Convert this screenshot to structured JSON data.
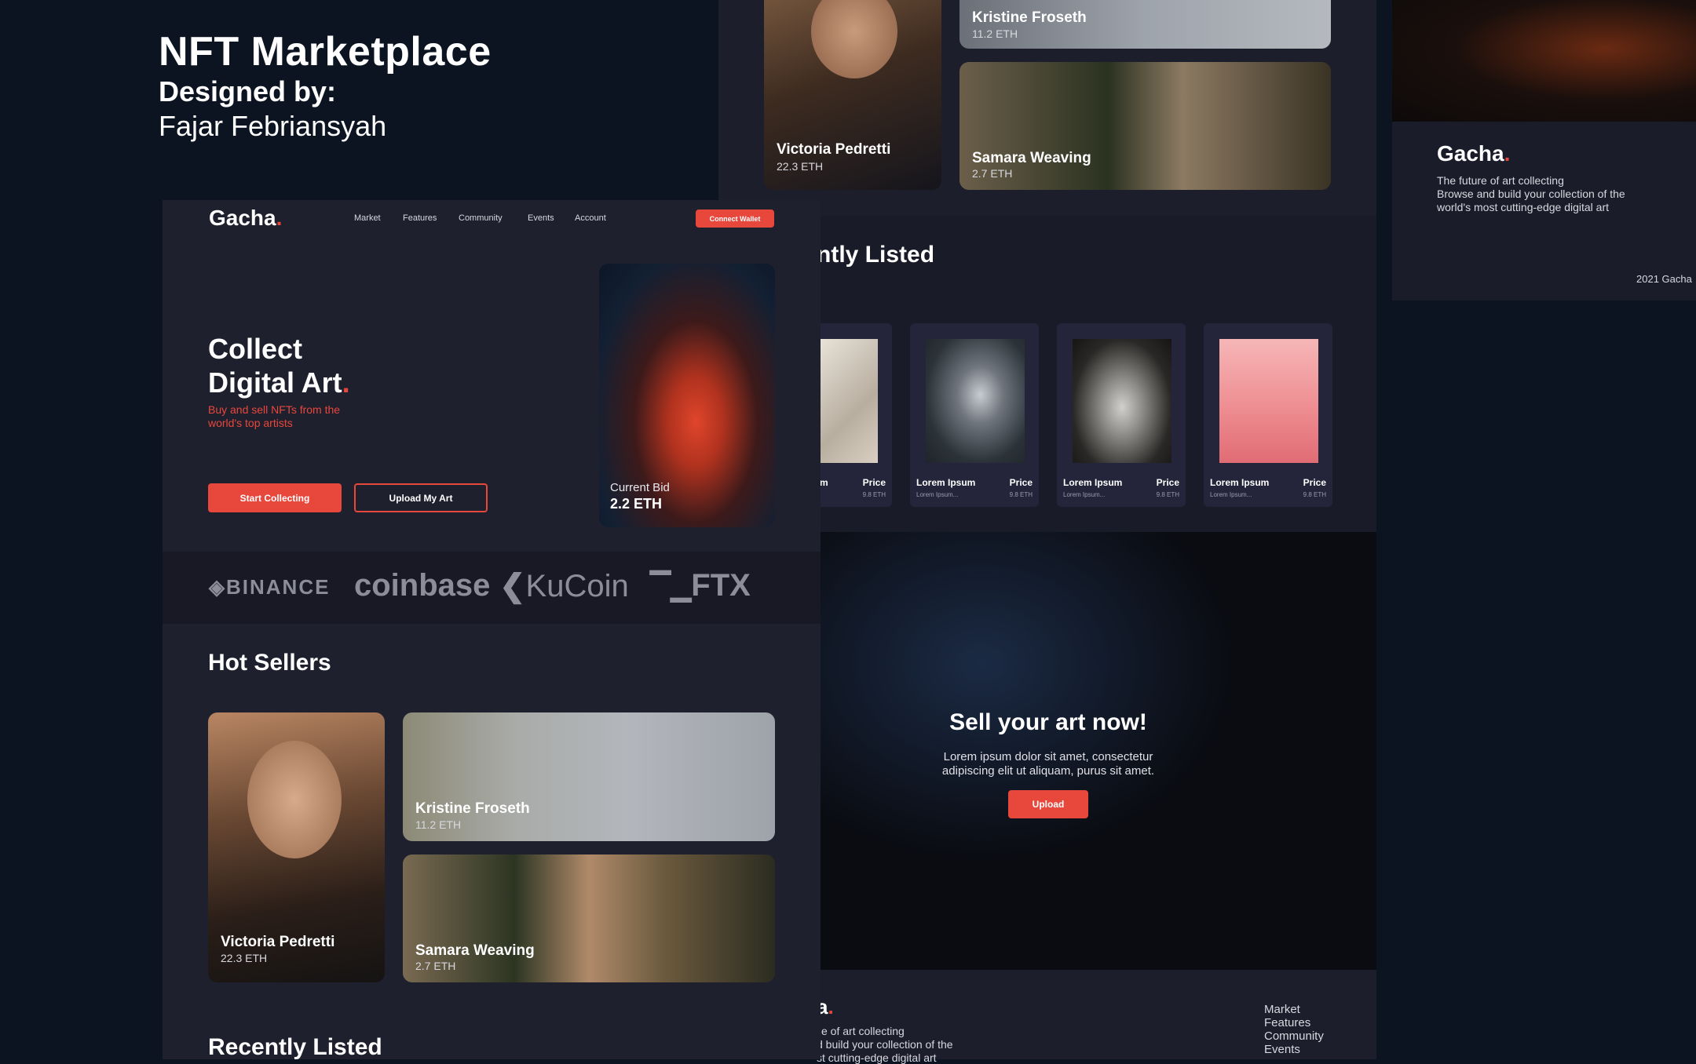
{
  "header": {
    "title": "NFT Marketplace",
    "designed_by": "Designed by:",
    "author": "Fajar Febriansyah"
  },
  "site": {
    "brand": "Gacha",
    "brand_dot": ".",
    "nav": [
      "Market",
      "Features",
      "Community",
      "Events",
      "Account"
    ],
    "connect_label": "Connect Wallet"
  },
  "hero": {
    "line1": "Collect",
    "line2": "Digital Art",
    "dot": ".",
    "subtitle": "Buy and sell NFTs from the world's top artists",
    "primary_label": "Start Collecting",
    "secondary_label": "Upload My Art",
    "bid_label": "Current Bid",
    "bid_value": "2.2 ETH"
  },
  "exchanges": [
    "BINANCE",
    "coinbase",
    "KuCoin",
    "FTX"
  ],
  "hot_sellers": {
    "heading": "Hot Sellers",
    "items": [
      {
        "name": "Victoria Pedretti",
        "price": "22.3 ETH"
      },
      {
        "name": "Kristine Froseth",
        "price": "11.2 ETH"
      },
      {
        "name": "Samara Weaving",
        "price": "2.7 ETH"
      }
    ]
  },
  "recently_listed": {
    "heading": "Recently Listed",
    "heading_partial": "ntly Listed",
    "items": [
      {
        "name": "m",
        "sub": "",
        "price_label": "Price",
        "price": "9.8 ETH"
      },
      {
        "name": "Lorem Ipsum",
        "sub": "Lorem Ipsum...",
        "price_label": "Price",
        "price": "9.8 ETH"
      },
      {
        "name": "Lorem Ipsum",
        "sub": "Lorem Ipsum...",
        "price_label": "Price",
        "price": "9.8 ETH"
      },
      {
        "name": "Lorem Ipsum",
        "sub": "Lorem Ipsum...",
        "price_label": "Price",
        "price": "9.8 ETH"
      }
    ]
  },
  "sell": {
    "heading": "Sell your art now!",
    "body1": "Lorem ipsum dolor sit amet, consectetur",
    "body2": "adipiscing elit ut aliquam, purus sit amet.",
    "upload_label": "Upload"
  },
  "footer_partial": {
    "brand": "a",
    "line1": "e of art collecting",
    "line2": "d build your collection of the",
    "line3": "st cutting-edge digital art",
    "links": [
      "Market",
      "Features",
      "Community",
      "Events"
    ]
  },
  "right_panel": {
    "brand": "Gacha",
    "line1": "The future of art collecting",
    "line2": "Browse and build your collection of the",
    "line3": "world's most cutting-edge digital art",
    "copyright": "2021 Gacha"
  },
  "colors": {
    "accent": "#e8473c",
    "bg": "#0c1422",
    "panel": "#1d1e2c"
  }
}
